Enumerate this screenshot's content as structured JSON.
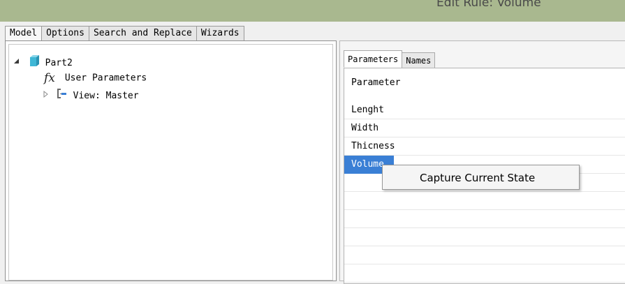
{
  "window": {
    "title": "Edit Rule: Volume"
  },
  "top_tabs": [
    {
      "label": "Model",
      "active": true
    },
    {
      "label": "Options",
      "active": false
    },
    {
      "label": "Search and Replace",
      "active": false
    },
    {
      "label": "Wizards",
      "active": false
    }
  ],
  "tree": {
    "root": {
      "label": "Part2",
      "expanded": true,
      "expander_icon": "triangle-expanded-icon",
      "icon": "part-cube-icon"
    },
    "children": [
      {
        "label": "User Parameters",
        "icon": "fx-icon"
      },
      {
        "label": "View: Master",
        "expanded": false,
        "expander_icon": "triangle-collapsed-icon",
        "icon": "view-tree-icon"
      }
    ]
  },
  "right_tabs": [
    {
      "label": "Parameters",
      "active": true
    },
    {
      "label": "Names",
      "active": false
    }
  ],
  "grid": {
    "header": "Parameter",
    "rows": [
      "Lenght",
      "Width",
      "Thicness",
      "Volume"
    ],
    "selected_row": "Volume"
  },
  "context_menu": {
    "items": [
      "Capture Current State"
    ]
  },
  "colors": {
    "titlebar": "#a9b88f",
    "selection": "#3a7fd5",
    "cube": "#3fb7d6"
  }
}
